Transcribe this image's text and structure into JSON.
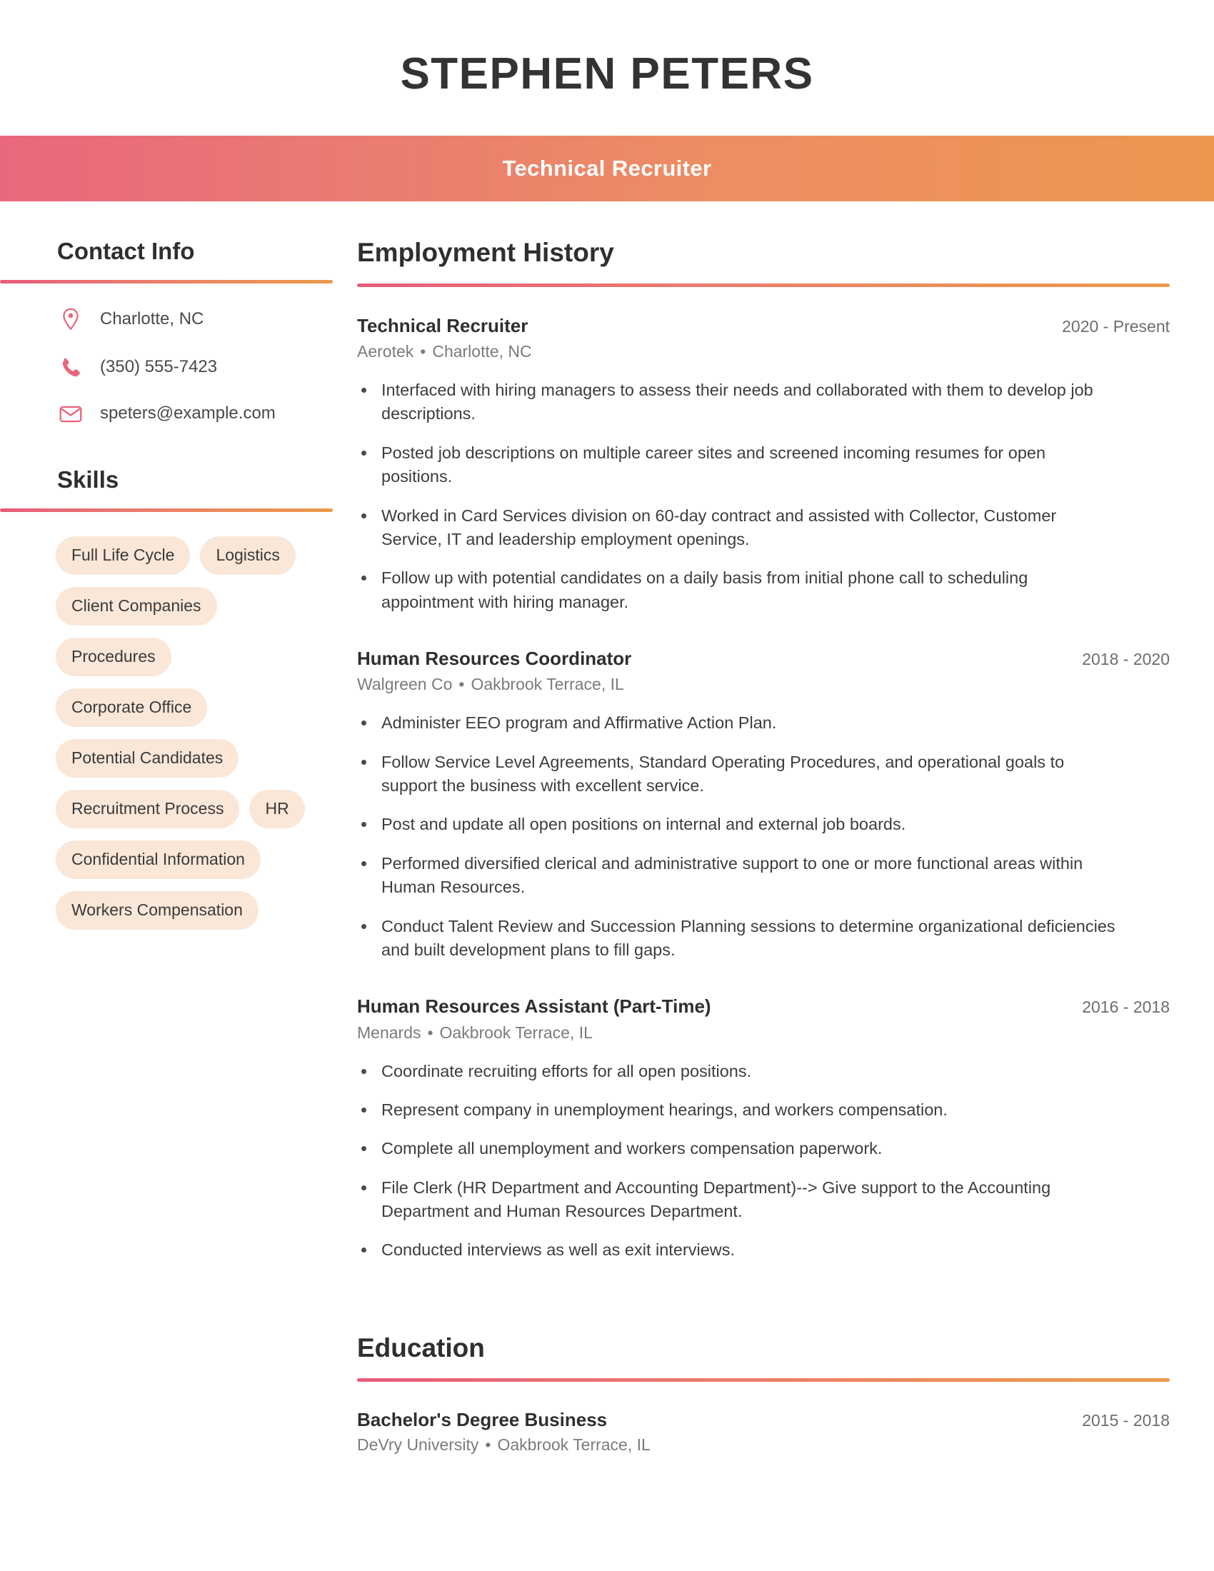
{
  "header": {
    "name": "STEPHEN PETERS",
    "job_title_banner": "Technical Recruiter"
  },
  "theme": {
    "gradient_start": "#e8677d",
    "gradient_end": "#ec9750",
    "skill_tag_bg": "#fae7d8",
    "heading_color": "#2f2f2f",
    "body_text_color": "#3d3d3d",
    "muted_text_color": "#7b7b7b"
  },
  "sidebar": {
    "contact": {
      "heading": "Contact Info",
      "items": [
        {
          "icon": "location-pin-icon",
          "text": "Charlotte, NC"
        },
        {
          "icon": "phone-icon",
          "text": "(350) 555-7423"
        },
        {
          "icon": "envelope-icon",
          "text": "speters@example.com"
        }
      ]
    },
    "skills": {
      "heading": "Skills",
      "items": [
        "Full Life Cycle",
        "Logistics",
        "Client Companies",
        "Procedures",
        "Corporate Office",
        "Potential Candidates",
        "Recruitment Process",
        "HR",
        "Confidential Information",
        "Workers Compensation"
      ]
    }
  },
  "main": {
    "employment": {
      "heading": "Employment History",
      "jobs": [
        {
          "title": "Technical Recruiter",
          "dates": "2020 - Present",
          "company": "Aerotek",
          "location": "Charlotte, NC",
          "bullets": [
            "Interfaced with hiring managers to assess their needs and collaborated with them to develop job descriptions.",
            "Posted job descriptions on multiple career sites and screened incoming resumes for open positions.",
            "Worked in Card Services division on 60-day contract and assisted with Collector, Customer Service, IT and leadership employment openings.",
            "Follow up with potential candidates on a daily basis from initial phone call to scheduling appointment with hiring manager."
          ]
        },
        {
          "title": "Human Resources Coordinator",
          "dates": "2018 - 2020",
          "company": "Walgreen Co",
          "location": "Oakbrook Terrace, IL",
          "bullets": [
            "Administer EEO program and Affirmative Action Plan.",
            "Follow Service Level Agreements, Standard Operating Procedures, and operational goals to support the business with excellent service.",
            "Post and update all open positions on internal and external job boards.",
            "Performed diversified clerical and administrative support to one or more functional areas within Human Resources.",
            "Conduct Talent Review and Succession Planning sessions to determine organizational deficiencies and built development plans to fill gaps."
          ]
        },
        {
          "title": "Human Resources Assistant (Part-Time)",
          "dates": "2016 - 2018",
          "company": "Menards",
          "location": "Oakbrook Terrace, IL",
          "bullets": [
            "Coordinate recruiting efforts for all open positions.",
            "Represent company in unemployment hearings, and workers compensation.",
            "Complete all unemployment and workers compensation paperwork.",
            "File Clerk (HR Department and Accounting Department)--> Give support to the Accounting Department and Human Resources Department.",
            "Conducted interviews as well as exit interviews."
          ]
        }
      ]
    },
    "education": {
      "heading": "Education",
      "entries": [
        {
          "degree": "Bachelor's Degree Business",
          "dates": "2015 - 2018",
          "school": "DeVry University",
          "location": "Oakbrook Terrace, IL"
        }
      ]
    }
  }
}
